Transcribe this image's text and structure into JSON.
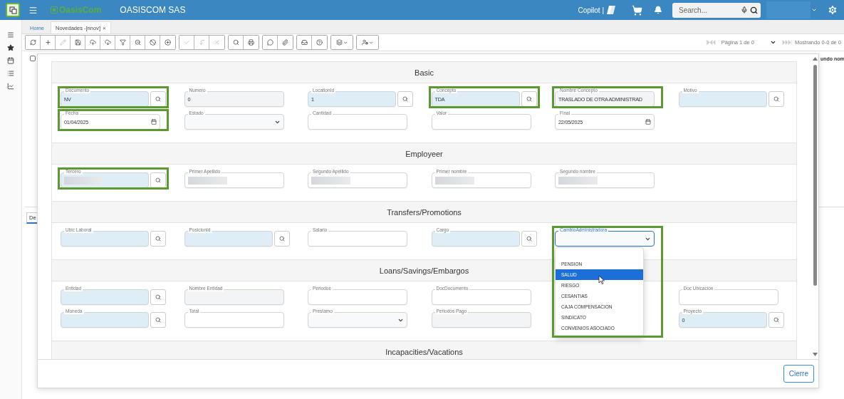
{
  "app": {
    "logo_text": "OasisCom",
    "company": "OASISCOM SAS"
  },
  "topbar": {
    "copilot": "Copilot |",
    "search": {
      "placeholder": "Search..."
    }
  },
  "tabs": [
    {
      "label": "Home",
      "selected": false
    },
    {
      "label": "Novedades -[nnov]",
      "selected": true,
      "close": "×"
    }
  ],
  "toolbar": [
    [
      {
        "kind": "refresh",
        "disabled": false
      },
      {
        "kind": "add",
        "disabled": false
      },
      {
        "kind": "edit",
        "disabled": true
      },
      {
        "kind": "save",
        "disabled": false
      },
      {
        "kind": "upload",
        "disabled": false
      },
      {
        "kind": "download",
        "disabled": false
      },
      {
        "kind": "filter",
        "disabled": false
      },
      {
        "kind": "zoomout",
        "disabled": false
      },
      {
        "kind": "ban",
        "disabled": false
      },
      {
        "kind": "addcircle",
        "disabled": false
      }
    ],
    [
      {
        "kind": "check",
        "disabled": true
      },
      {
        "kind": "undo",
        "disabled": true
      },
      {
        "kind": "cancel",
        "disabled": true
      }
    ],
    [
      {
        "kind": "search",
        "disabled": false
      },
      {
        "kind": "print",
        "disabled": false
      }
    ],
    [
      {
        "kind": "comment",
        "disabled": false
      },
      {
        "kind": "attach",
        "disabled": false
      }
    ],
    [
      {
        "kind": "tray",
        "disabled": false
      },
      {
        "kind": "help",
        "disabled": false
      }
    ],
    [
      {
        "kind": "layers",
        "disabled": false
      }
    ],
    [
      {
        "kind": "usercog",
        "disabled": false
      }
    ]
  ],
  "pager": {
    "page": "Página 1 de 0",
    "showing": "Mostrando 0-0 de 0"
  },
  "grid": {
    "checked": false,
    "column_header": "undo nom"
  },
  "bottom_tab": "De",
  "form": {
    "sections": [
      {
        "title": "Basic",
        "rows": [
          [
            {
              "label": "Documento",
              "kind": "lookup",
              "value": "NV",
              "highlighted": true
            },
            {
              "label": "Numero",
              "kind": "readonly",
              "value": "0"
            },
            {
              "label": "LocationId",
              "kind": "lookup",
              "value": "1"
            },
            {
              "label": "Concepto",
              "kind": "lookup",
              "value": "TDA",
              "highlighted": true
            },
            {
              "label": "Nombre Concepto",
              "kind": "readonly",
              "value": "TRASLADO DE OTRA ADMINISTRAD",
              "highlighted": true
            },
            {
              "label": "Motivo",
              "kind": "lookup"
            }
          ],
          [
            {
              "label": "Fecha",
              "kind": "date",
              "value": "01/04/2025",
              "highlighted": true
            },
            {
              "label": "Estado",
              "kind": "select"
            },
            {
              "label": "Cantidad",
              "kind": "text"
            },
            {
              "label": "Valor",
              "kind": "text"
            },
            {
              "label": "Final",
              "kind": "date",
              "value": "22/05/2025"
            },
            null
          ]
        ]
      },
      {
        "title": "Employeer",
        "rows": [
          [
            {
              "label": "Tercero",
              "kind": "lookup",
              "redacted": true,
              "highlighted": true
            },
            {
              "label": "Primer Apellido",
              "kind": "text",
              "redacted": true
            },
            {
              "label": "Segundo Apellido",
              "kind": "text",
              "redacted": true
            },
            {
              "label": "Primer nombre",
              "kind": "text",
              "redacted": true
            },
            {
              "label": "Segundo nombre",
              "kind": "text",
              "redacted": true
            },
            null
          ]
        ]
      },
      {
        "title": "Transfers/Promotions",
        "rows": [
          [
            {
              "label": "Ubic Laboral",
              "kind": "lookup"
            },
            {
              "label": "PosicionId",
              "kind": "lookup"
            },
            {
              "label": "Salario",
              "kind": "text"
            },
            {
              "label": "Cargo",
              "kind": "lookup"
            },
            {
              "label": "CambioAdministradora",
              "kind": "select",
              "highlighted": true,
              "expanded": true,
              "options": [
                {
                  "label": "PENSION",
                  "selected": false
                },
                {
                  "label": "SALUD",
                  "selected": true
                },
                {
                  "label": "RIESGO",
                  "selected": false
                },
                {
                  "label": "CESANTIAS",
                  "selected": false
                },
                {
                  "label": "CAJA COMPENSACION",
                  "selected": false
                },
                {
                  "label": "SINDICATO",
                  "selected": false
                },
                {
                  "label": "CONVENIOS ASOCIADO",
                  "selected": false
                }
              ]
            },
            null
          ]
        ]
      },
      {
        "title": "Loans/Savings/Embargos",
        "rows": [
          [
            {
              "label": "Entidad",
              "kind": "lookup"
            },
            {
              "label": "Nombre Entidad",
              "kind": "readonly"
            },
            {
              "label": "Periodos",
              "kind": "text"
            },
            {
              "label": "DocDocumento",
              "kind": "text"
            },
            null,
            {
              "label": "Doc Ubicación",
              "kind": "text"
            }
          ],
          [
            {
              "label": "Moneda",
              "kind": "lookup"
            },
            {
              "label": "Total",
              "kind": "text"
            },
            {
              "label": "Prestamo",
              "kind": "select"
            },
            {
              "label": "Periodos Pago",
              "kind": "readonly"
            },
            null,
            {
              "label": "Proyecto",
              "kind": "lookup",
              "value": "0"
            }
          ]
        ]
      },
      {
        "title": "Incapacities/Vacations"
      }
    ],
    "close_button": "Cierre"
  }
}
